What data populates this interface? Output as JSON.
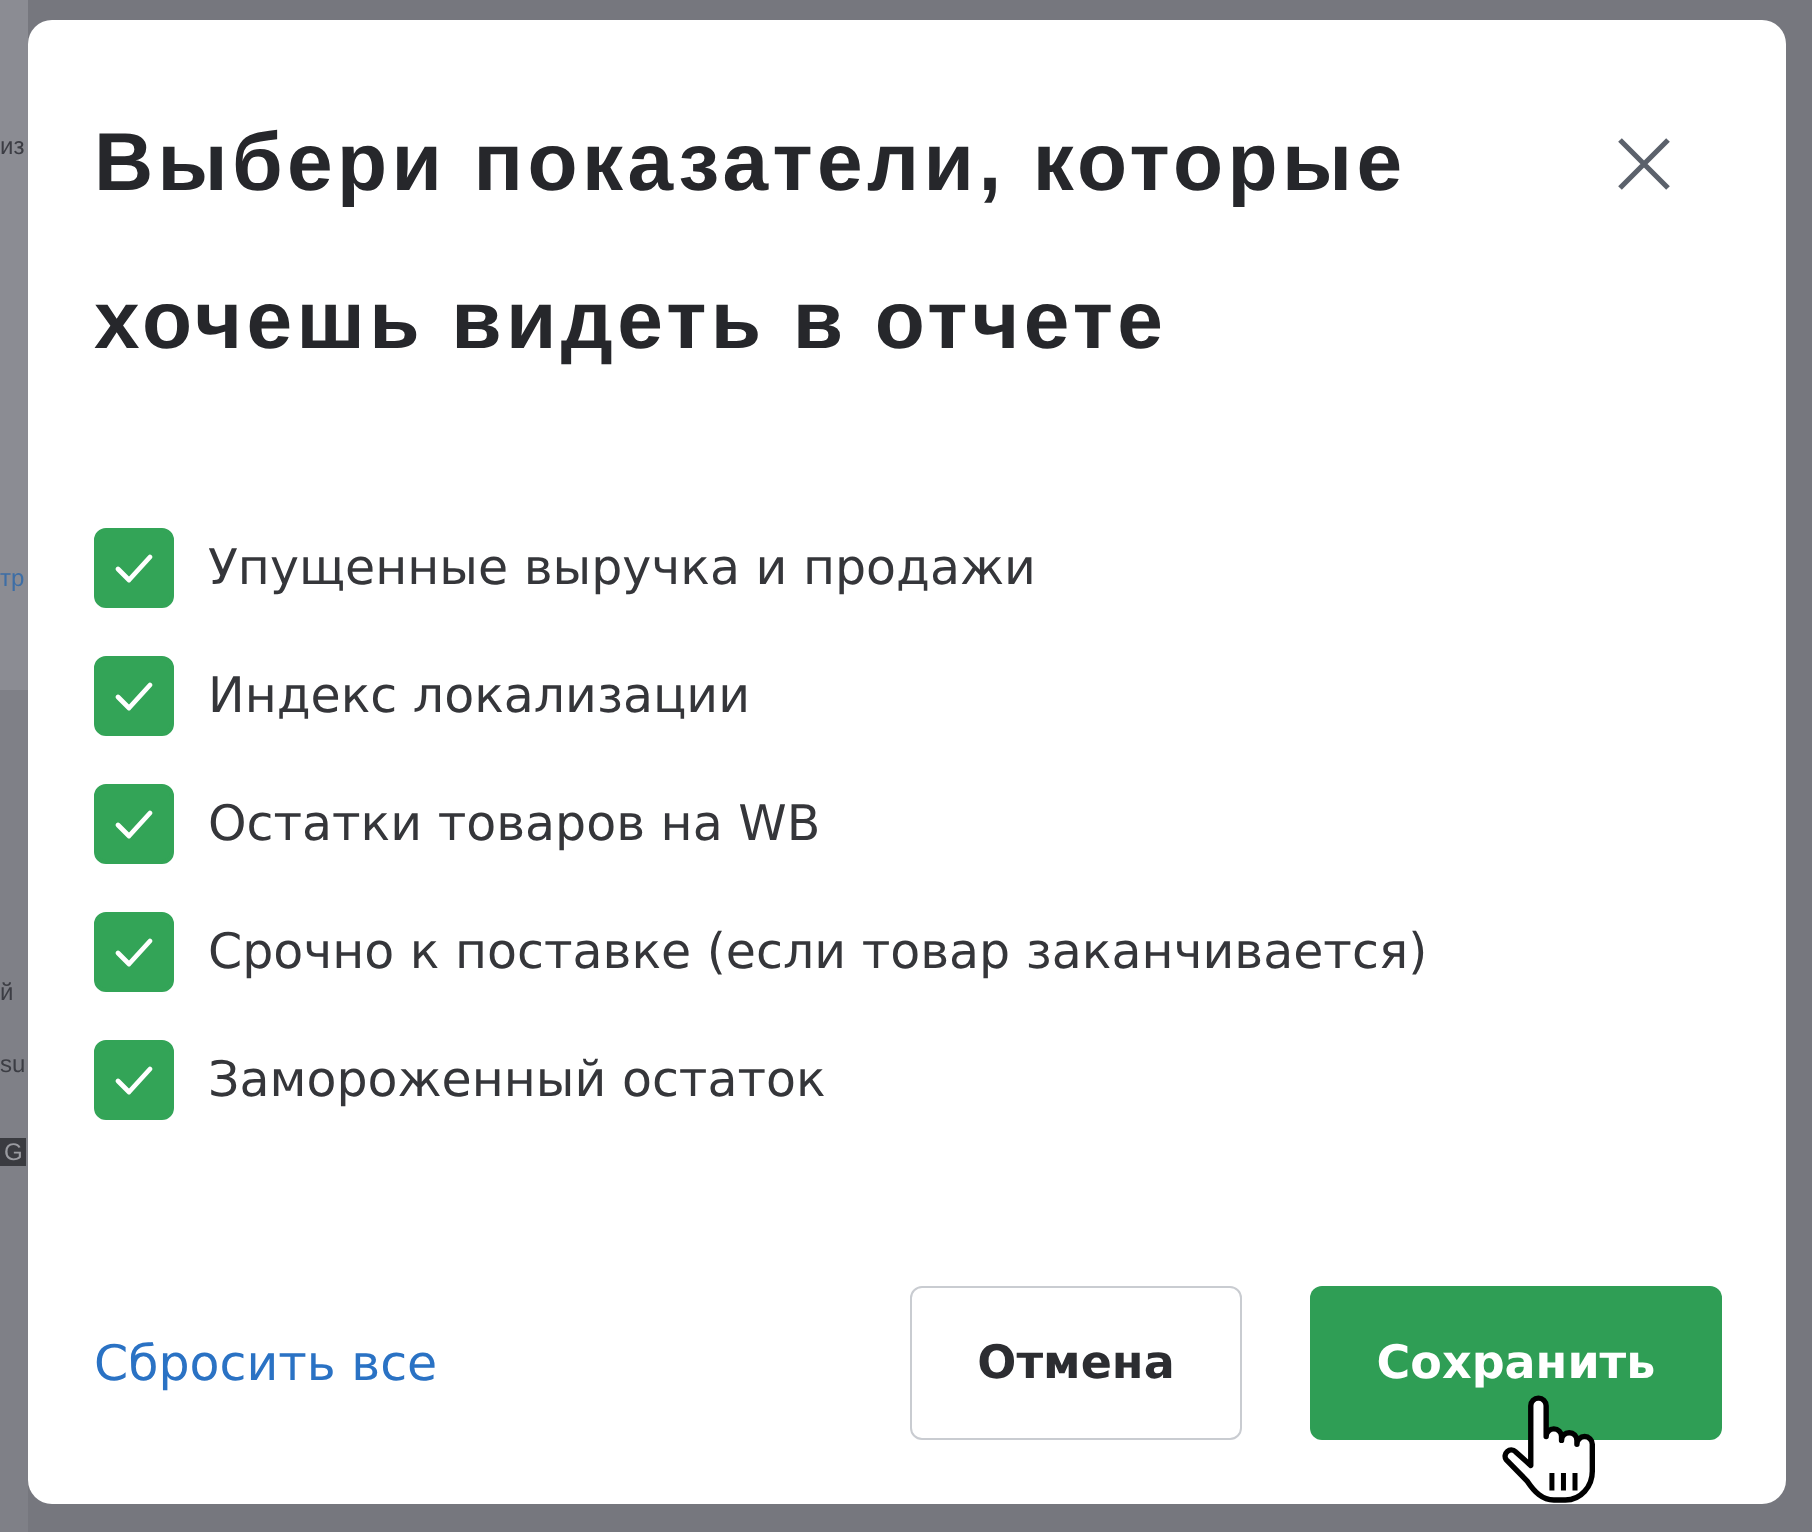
{
  "background_fragments": [
    {
      "text": "из",
      "kind": "label"
    },
    {
      "text": "тр",
      "kind": "link"
    },
    {
      "text": "й",
      "kind": "label"
    },
    {
      "text": "su",
      "kind": "label"
    },
    {
      "text": "G",
      "kind": "badge"
    }
  ],
  "dialog": {
    "title": "Выбери показатели, которые хочешь видеть в отчете",
    "options": [
      {
        "label": "Упущенные выручка и продажи",
        "checked": true
      },
      {
        "label": "Индекс локализации",
        "checked": true
      },
      {
        "label": "Остатки товаров на WB",
        "checked": true
      },
      {
        "label": "Срочно к поставке (если товар заканчивается)",
        "checked": true
      },
      {
        "label": "Замороженный остаток",
        "checked": true
      }
    ],
    "reset_link": "Сбросить все",
    "buttons": [
      {
        "label": "Отмена",
        "kind": "secondary"
      },
      {
        "label": "Сохранить",
        "kind": "primary"
      }
    ]
  }
}
